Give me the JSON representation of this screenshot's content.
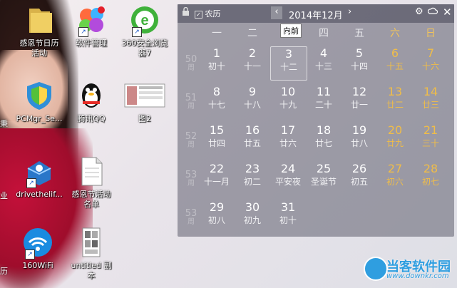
{
  "desktop": {
    "icons": [
      {
        "label": "感恩节日历\n活动",
        "name": "desktop-icon-gratitude-calendar"
      },
      {
        "label": "软件管理",
        "name": "desktop-icon-software-manager"
      },
      {
        "label": "360安全浏览\n器7",
        "name": "desktop-icon-360-browser"
      },
      {
        "label": "PCMgr_Se...",
        "name": "desktop-icon-pcmgr"
      },
      {
        "label": "腾讯QQ",
        "name": "desktop-icon-qq"
      },
      {
        "label": "图2",
        "name": "desktop-icon-image2"
      },
      {
        "label": "drivethelif...",
        "name": "desktop-icon-drivethelife"
      },
      {
        "label": "感恩节活动\n名单",
        "name": "desktop-icon-gratitude-list"
      },
      {
        "label": "160WiFi",
        "name": "desktop-icon-160wifi"
      },
      {
        "label": "untitled 副\n本",
        "name": "desktop-icon-untitled-copy"
      }
    ],
    "partial_labels": [
      "秉",
      "业",
      "历"
    ]
  },
  "calendar": {
    "lunar_toggle_label": "农历",
    "month_title": "2014年12月",
    "tooltip": "向前",
    "weekdays": [
      "一",
      "二",
      "三",
      "四",
      "五",
      "六",
      "日"
    ],
    "week_numbers": [
      {
        "n": "50",
        "w": "周"
      },
      {
        "n": "51",
        "w": "周"
      },
      {
        "n": "52",
        "w": "周"
      },
      {
        "n": "53",
        "w": "周"
      },
      {
        "n": "53",
        "w": "周"
      }
    ],
    "weeks": [
      [
        {
          "d": "1",
          "l": "初十"
        },
        {
          "d": "2",
          "l": "十一"
        },
        {
          "d": "3",
          "l": "十二"
        },
        {
          "d": "4",
          "l": "十三"
        },
        {
          "d": "5",
          "l": "十四"
        },
        {
          "d": "6",
          "l": "十五"
        },
        {
          "d": "7",
          "l": "十六"
        }
      ],
      [
        {
          "d": "8",
          "l": "十七"
        },
        {
          "d": "9",
          "l": "十八"
        },
        {
          "d": "10",
          "l": "十九"
        },
        {
          "d": "11",
          "l": "二十"
        },
        {
          "d": "12",
          "l": "廿一"
        },
        {
          "d": "13",
          "l": "廿二"
        },
        {
          "d": "14",
          "l": "廿三"
        }
      ],
      [
        {
          "d": "15",
          "l": "廿四"
        },
        {
          "d": "16",
          "l": "廿五"
        },
        {
          "d": "17",
          "l": "廿六"
        },
        {
          "d": "18",
          "l": "廿七"
        },
        {
          "d": "19",
          "l": "廿八"
        },
        {
          "d": "20",
          "l": "廿九"
        },
        {
          "d": "21",
          "l": "三十"
        }
      ],
      [
        {
          "d": "22",
          "l": "十一月"
        },
        {
          "d": "23",
          "l": "初二"
        },
        {
          "d": "24",
          "l": "平安夜"
        },
        {
          "d": "25",
          "l": "圣诞节"
        },
        {
          "d": "26",
          "l": "初五"
        },
        {
          "d": "27",
          "l": "初六"
        },
        {
          "d": "28",
          "l": "初七"
        }
      ],
      [
        {
          "d": "29",
          "l": "初八"
        },
        {
          "d": "30",
          "l": "初九"
        },
        {
          "d": "31",
          "l": "初十"
        }
      ]
    ],
    "today": "3",
    "colors": {
      "weekend": "#f0bd48",
      "panel": "#5f5f6e"
    }
  },
  "watermark": {
    "brand": "当客软件园",
    "url": "www.downkr.com"
  }
}
